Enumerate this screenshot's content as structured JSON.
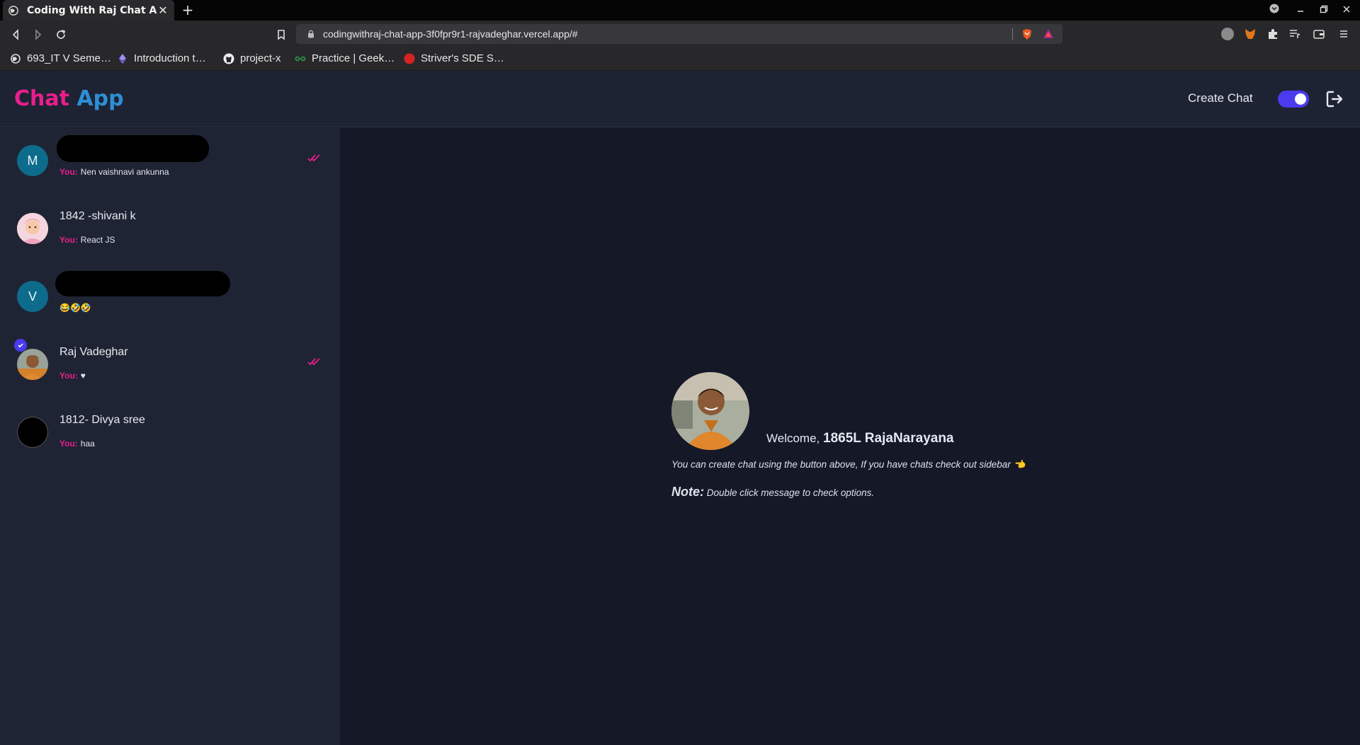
{
  "browser": {
    "tab_title": "Coding With Raj Chat App",
    "url": "codingwithraj-chat-app-3f0fpr9r1-rajvadeghar.vercel.app/#",
    "bookmarks": [
      {
        "label": "693_IT V Seme…",
        "icon": "globe-icon"
      },
      {
        "label": "Introduction t…",
        "icon": "ethereum-icon"
      },
      {
        "label": "project-x",
        "icon": "github-icon"
      },
      {
        "label": "Practice | Geek…",
        "icon": "geeksforgeeks-icon"
      },
      {
        "label": "Striver's SDE S…",
        "icon": "tuf-icon"
      }
    ]
  },
  "header": {
    "logo_part1": "Chat",
    "logo_part2": "App",
    "create_chat_label": "Create Chat",
    "dark_mode_on": true,
    "accent_color": "#4a3bf0",
    "brand_pink": "#e91e8c",
    "brand_blue": "#2d8fd6"
  },
  "sidebar": {
    "chats": [
      {
        "avatar_letter": "M",
        "name": "",
        "name_redacted": true,
        "you_label": "You:",
        "last_message": "Nen vaishnavi ankunna",
        "read_ticks": true,
        "avatar_color": "#0d6c8c"
      },
      {
        "avatar_letter": "",
        "name": "1842 -shivani k",
        "name_redacted": false,
        "you_label": "You:",
        "last_message": "React JS",
        "read_ticks": false,
        "avatar_color": "#f2c9d4"
      },
      {
        "avatar_letter": "V",
        "name": "",
        "name_redacted": true,
        "you_label": "",
        "last_message": "😂🤣🤣",
        "read_ticks": false,
        "avatar_color": "#0d6c8c"
      },
      {
        "avatar_letter": "",
        "name": "Raj Vadeghar",
        "name_redacted": false,
        "you_label": "You:",
        "last_message": "♥",
        "read_ticks": true,
        "verified": true,
        "avatar_color": "#c98a4a"
      },
      {
        "avatar_letter": "",
        "name": "1812- Divya sree",
        "name_redacted": false,
        "you_label": "You:",
        "last_message": "haa",
        "read_ticks": false,
        "avatar_color": "#000000"
      }
    ]
  },
  "main": {
    "welcome_prefix": "Welcome,",
    "username": "1865L RajaNarayana",
    "hint": "You can create chat using the button above, If you have chats check out sidebar 👈",
    "note_label": "Note:",
    "note_text": "Double click message to check options."
  }
}
